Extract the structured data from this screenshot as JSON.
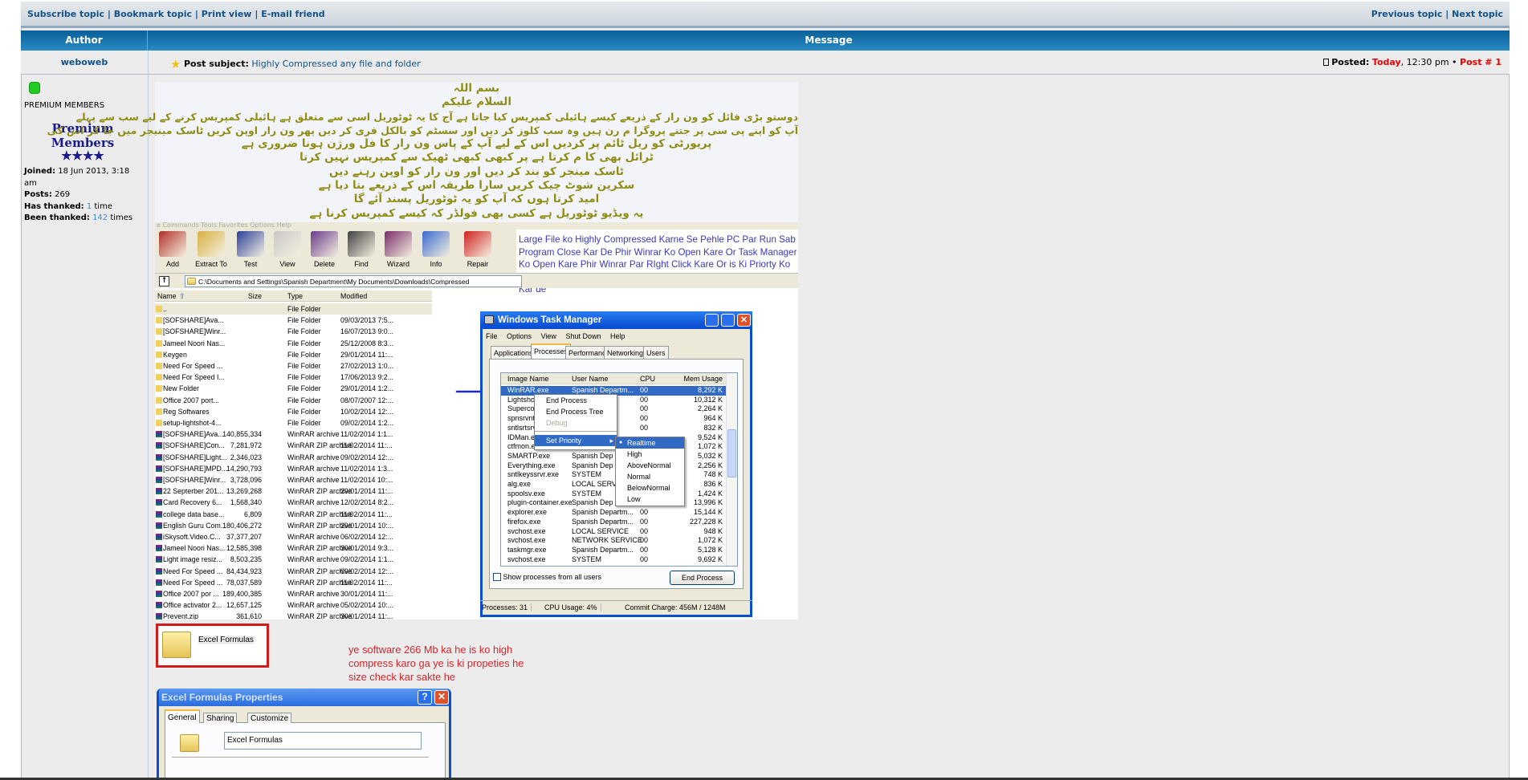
{
  "topbar": {
    "left_links": [
      "Subscribe topic",
      "Bookmark topic",
      "Print view",
      "E-mail friend"
    ],
    "right_links": [
      "Previous topic",
      "Next topic"
    ],
    "separator": "|"
  },
  "header": {
    "author": "Author",
    "message": "Message"
  },
  "post": {
    "author": "weboweb",
    "subject_label": "Post subject:",
    "subject": "Highly Compressed any file and folder",
    "posted_label": "Posted:",
    "posted_day": "Today",
    "posted_time": ", 12:30 pm",
    "bullet": "•",
    "post_number": "Post # 1"
  },
  "profile": {
    "rank": "PREMIUM MEMBERS",
    "rank_image_text": "Premium Members",
    "rank_stars": "★★★★",
    "joined_label": "Joined:",
    "joined": "18 Jun 2013, 3:18 am",
    "posts_label": "Posts:",
    "posts": "269",
    "thanked_label": "Has thanked:",
    "thanked_count": "1",
    "thanked_unit": "time",
    "been_thanked_label": "Been thanked:",
    "been_thanked_count": "142",
    "been_thanked_unit": "times"
  },
  "urdu_lines": [
    "بسم اللہ",
    "السلام علیکم",
    "دوستو بڑی فائل کو ون رار کے ذریعے کیسے ہائیلی کمپریس کیا جاتا ہے آج کا یہ ٹوٹوریل اسی سے متعلق ہے ہائیلی کمپریس کرنے کے لیے سب سے پہلے",
    "آپ کو اپنے پی سی پر جتنے پروگرا م رن ہیں وہ سب کلوز کر دیں اور سسٹم کو بالکل فری کر دیں پھر ون رار اوپن کریں ٹاسک مینیجر میں جا کر اس کی",
    "پریورٹی کو ریل ٹائم پر کردیں اس کے لیے آپ کے پاس ون رار کا فل ورژن ہونا ضروری ہے",
    "ٹرائل بھی کا م کرتا ہے پر کبھی کبھی ٹھیک سے کمپریس نہیں کرتا",
    "ٹاسک مینجر کو بند کر دیں اور ون رار کو اوپن رہنے دیں",
    "سکرین شوٹ چیک کریں سارا طریقہ اس کے ذریعے بتا دیا ہے",
    "امید کرتا ہوں کہ آپ کو یہ ٹوٹوریل پسند آئے گا",
    "یہ ویڈیو ٹوٹوریل ہے کسی بھی فولڈر کہ کیسے کمپریس کرنا ہے"
  ],
  "winrar": {
    "menu": "e   Commands   Tools   Favorites   Options   Help",
    "toolbar": [
      {
        "label": "Add",
        "icon": "add-archive-icon",
        "color": "#b0302a"
      },
      {
        "label": "Extract To",
        "icon": "extract-icon",
        "color": "#d8b040"
      },
      {
        "label": "Test",
        "icon": "test-icon",
        "color": "#2a3e9a"
      },
      {
        "label": "View",
        "icon": "view-icon",
        "color": "#c8c8c8"
      },
      {
        "label": "Delete",
        "icon": "delete-icon",
        "color": "#6a3a8a"
      },
      {
        "label": "Find",
        "icon": "find-icon",
        "color": "#404040"
      },
      {
        "label": "Wizard",
        "icon": "wizard-icon",
        "color": "#7a2a6a"
      },
      {
        "label": "Info",
        "icon": "info-icon",
        "color": "#3a6ad0"
      },
      {
        "label": "Repair",
        "icon": "repair-icon",
        "color": "#d02020"
      }
    ],
    "path": "C:\\Documents and Settings\\Spanish Department\\My Documents\\Downloads\\Compressed",
    "columns": [
      "Name",
      "Size",
      "Type",
      "Modified"
    ],
    "files": [
      {
        "name": "..",
        "size": "",
        "type": "File Folder",
        "modified": "",
        "kind": "folder"
      },
      {
        "name": "[SOFSHARE]Ava...",
        "size": "",
        "type": "File Folder",
        "modified": "09/03/2013 7:5...",
        "kind": "folder"
      },
      {
        "name": "[SOFSHARE]Winr...",
        "size": "",
        "type": "File Folder",
        "modified": "16/07/2013 9:0...",
        "kind": "folder"
      },
      {
        "name": "Jameel Noori Nas...",
        "size": "",
        "type": "File Folder",
        "modified": "25/12/2008 8:3...",
        "kind": "folder"
      },
      {
        "name": "Keygen",
        "size": "",
        "type": "File Folder",
        "modified": "29/01/2014 11:...",
        "kind": "folder"
      },
      {
        "name": "Need For Speed  ...",
        "size": "",
        "type": "File Folder",
        "modified": "27/02/2013 1:0...",
        "kind": "folder"
      },
      {
        "name": "Need For Speed I...",
        "size": "",
        "type": "File Folder",
        "modified": "17/06/2013 9:2...",
        "kind": "folder"
      },
      {
        "name": "New Folder",
        "size": "",
        "type": "File Folder",
        "modified": "29/01/2014 1:2...",
        "kind": "folder"
      },
      {
        "name": "Office 2007 port...",
        "size": "",
        "type": "File Folder",
        "modified": "08/07/2007 12:...",
        "kind": "folder"
      },
      {
        "name": "Reg Softwares",
        "size": "",
        "type": "File Folder",
        "modified": "10/02/2014 12:...",
        "kind": "folder"
      },
      {
        "name": "setup-lightshot-4...",
        "size": "",
        "type": "File Folder",
        "modified": "09/02/2014 1:2...",
        "kind": "folder"
      },
      {
        "name": "[SOFSHARE]Ava...",
        "size": "140,855,334",
        "type": "WinRAR archive",
        "modified": "11/02/2014 1:1...",
        "kind": "rar"
      },
      {
        "name": "[SOFSHARE]Con...",
        "size": "7,281,972",
        "type": "WinRAR ZIP archive",
        "modified": "11/02/2014 11:...",
        "kind": "rar"
      },
      {
        "name": "[SOFSHARE]Light...",
        "size": "2,346,023",
        "type": "WinRAR archive",
        "modified": "09/02/2014 12:...",
        "kind": "rar"
      },
      {
        "name": "[SOFSHARE]MPD...",
        "size": "14,290,793",
        "type": "WinRAR archive",
        "modified": "11/02/2014 1:3...",
        "kind": "rar"
      },
      {
        "name": "[SOFSHARE]Winr...",
        "size": "3,728,096",
        "type": "WinRAR archive",
        "modified": "11/02/2014 10:...",
        "kind": "rar"
      },
      {
        "name": "22 Septerber 201...",
        "size": "13,269,268",
        "type": "WinRAR ZIP archive",
        "modified": "29/01/2014 11:...",
        "kind": "rar"
      },
      {
        "name": "Card Recovery 6...",
        "size": "1,568,340",
        "type": "WinRAR archive",
        "modified": "12/02/2014 8:2...",
        "kind": "rar"
      },
      {
        "name": "college data base...",
        "size": "6,809",
        "type": "WinRAR ZIP archive",
        "modified": "11/02/2014 11:...",
        "kind": "rar"
      },
      {
        "name": "English Guru Com...",
        "size": "180,406,272",
        "type": "WinRAR ZIP archive",
        "modified": "29/01/2014 10:...",
        "kind": "rar"
      },
      {
        "name": "iSkysoft.Video.C...",
        "size": "37,377,207",
        "type": "WinRAR archive",
        "modified": "06/02/2014 12:...",
        "kind": "rar"
      },
      {
        "name": "Jameel Noori Nas...",
        "size": "12,585,398",
        "type": "WinRAR ZIP archive",
        "modified": "30/01/2014 9:3...",
        "kind": "rar"
      },
      {
        "name": "Light image resiz...",
        "size": "8,503,235",
        "type": "WinRAR archive",
        "modified": "09/02/2014 1:1...",
        "kind": "rar"
      },
      {
        "name": "Need For Speed ...",
        "size": "84,434,923",
        "type": "WinRAR ZIP archive",
        "modified": "09/02/2014 12:...",
        "kind": "rar"
      },
      {
        "name": "Need For Speed  ...",
        "size": "78,037,589",
        "type": "WinRAR ZIP archive",
        "modified": "11/02/2014 11:...",
        "kind": "rar"
      },
      {
        "name": "Office 2007 por ...",
        "size": "189,400,385",
        "type": "WinRAR archive",
        "modified": "30/01/2014 11:...",
        "kind": "rar"
      },
      {
        "name": "Office activator 2...",
        "size": "12,657,125",
        "type": "WinRAR archive",
        "modified": "05/02/2014 10:...",
        "kind": "rar"
      },
      {
        "name": "Prevent.zip",
        "size": "361,610",
        "type": "WinRAR ZIP archive",
        "modified": "30/01/2014 11:...",
        "kind": "rar"
      }
    ]
  },
  "instructions_blue": "Large File ko Highly Compressed Karne Se Pehle PC Par Run Sab Program Close Kar De Phir Winrar Ko Open Kare Or Task Manager Ko Open Kare Phir Winrar Par RIght Click Kare Or is Ki Priorty Ko Real Time Par Kar de  or Phir Winrar or Task Mang Dono ko Close Kar de",
  "task_manager": {
    "title": "Windows Task Manager",
    "menu": [
      "File",
      "Options",
      "View",
      "Shut Down",
      "Help"
    ],
    "tabs": [
      "Applications",
      "Processes",
      "Performance",
      "Networking",
      "Users"
    ],
    "active_tab": "Processes",
    "columns": [
      "Image Name",
      "User Name",
      "CPU",
      "Mem Usage"
    ],
    "processes": [
      {
        "name": "WinRAR.exe",
        "user": "Spanish Departm...",
        "cpu": "00",
        "mem": "8,292 K"
      },
      {
        "name": "Lightshot",
        "user": "",
        "cpu": "00",
        "mem": "10,312 K"
      },
      {
        "name": "Supercop",
        "user": "",
        "cpu": "00",
        "mem": "2,264 K"
      },
      {
        "name": "spnsrvnt",
        "user": "",
        "cpu": "00",
        "mem": "964 K"
      },
      {
        "name": "sntlsrtsrv",
        "user": "",
        "cpu": "00",
        "mem": "832 K"
      },
      {
        "name": "IDMan.exe",
        "user": "",
        "cpu": "",
        "mem": "9,524 K"
      },
      {
        "name": "ctfmon.exe",
        "user": "",
        "cpu": "",
        "mem": "1,072 K"
      },
      {
        "name": "SMARTP.exe",
        "user": "Spanish Dep",
        "cpu": "",
        "mem": "5,032 K"
      },
      {
        "name": "Everything.exe",
        "user": "Spanish Dep",
        "cpu": "",
        "mem": "2,256 K"
      },
      {
        "name": "sntlkeyssrvr.exe",
        "user": "SYSTEM",
        "cpu": "",
        "mem": "748 K"
      },
      {
        "name": "alg.exe",
        "user": "LOCAL SERV",
        "cpu": "",
        "mem": "836 K"
      },
      {
        "name": "spoolsv.exe",
        "user": "SYSTEM",
        "cpu": "",
        "mem": "1,424 K"
      },
      {
        "name": "plugin-container.exe",
        "user": "Spanish Dep",
        "cpu": "",
        "mem": "13,996 K"
      },
      {
        "name": "explorer.exe",
        "user": "Spanish Departm...",
        "cpu": "00",
        "mem": "15,144 K"
      },
      {
        "name": "firefox.exe",
        "user": "Spanish Departm...",
        "cpu": "00",
        "mem": "227,228 K"
      },
      {
        "name": "svchost.exe",
        "user": "LOCAL SERVICE",
        "cpu": "00",
        "mem": "948 K"
      },
      {
        "name": "svchost.exe",
        "user": "NETWORK SERVICE",
        "cpu": "00",
        "mem": "1,072 K"
      },
      {
        "name": "taskmgr.exe",
        "user": "Spanish Departm...",
        "cpu": "00",
        "mem": "5,128 K"
      },
      {
        "name": "svchost.exe",
        "user": "SYSTEM",
        "cpu": "00",
        "mem": "9,692 K"
      }
    ],
    "context_menu": [
      "End Process",
      "End Process Tree",
      "Debug",
      "Set Priority"
    ],
    "priority_menu": [
      "Realtime",
      "High",
      "AboveNormal",
      "Normal",
      "BelowNormal",
      "Low"
    ],
    "selected_priority": "Realtime",
    "show_all_label": "Show processes from all users",
    "end_process_button": "End Process",
    "status": {
      "processes": "Processes: 31",
      "cpu": "CPU Usage: 4%",
      "commit": "Commit Charge: 456M / 1248M"
    }
  },
  "folder_item": "Excel Formulas",
  "red_note": [
    "ye software 266 Mb ka he is ko high",
    "compress karo ga ye is ki propeties he",
    "size check kar sakte he"
  ],
  "properties": {
    "title": "Excel Formulas Properties",
    "tabs": [
      "General",
      "Sharing",
      "Customize"
    ],
    "name_value": "Excel Formulas"
  },
  "colors": {
    "header_blue": "#0a5f97",
    "link": "#105289",
    "accent_red": "#e00000",
    "urdu_text": "#8e8e16",
    "note_red": "#d0262a"
  }
}
